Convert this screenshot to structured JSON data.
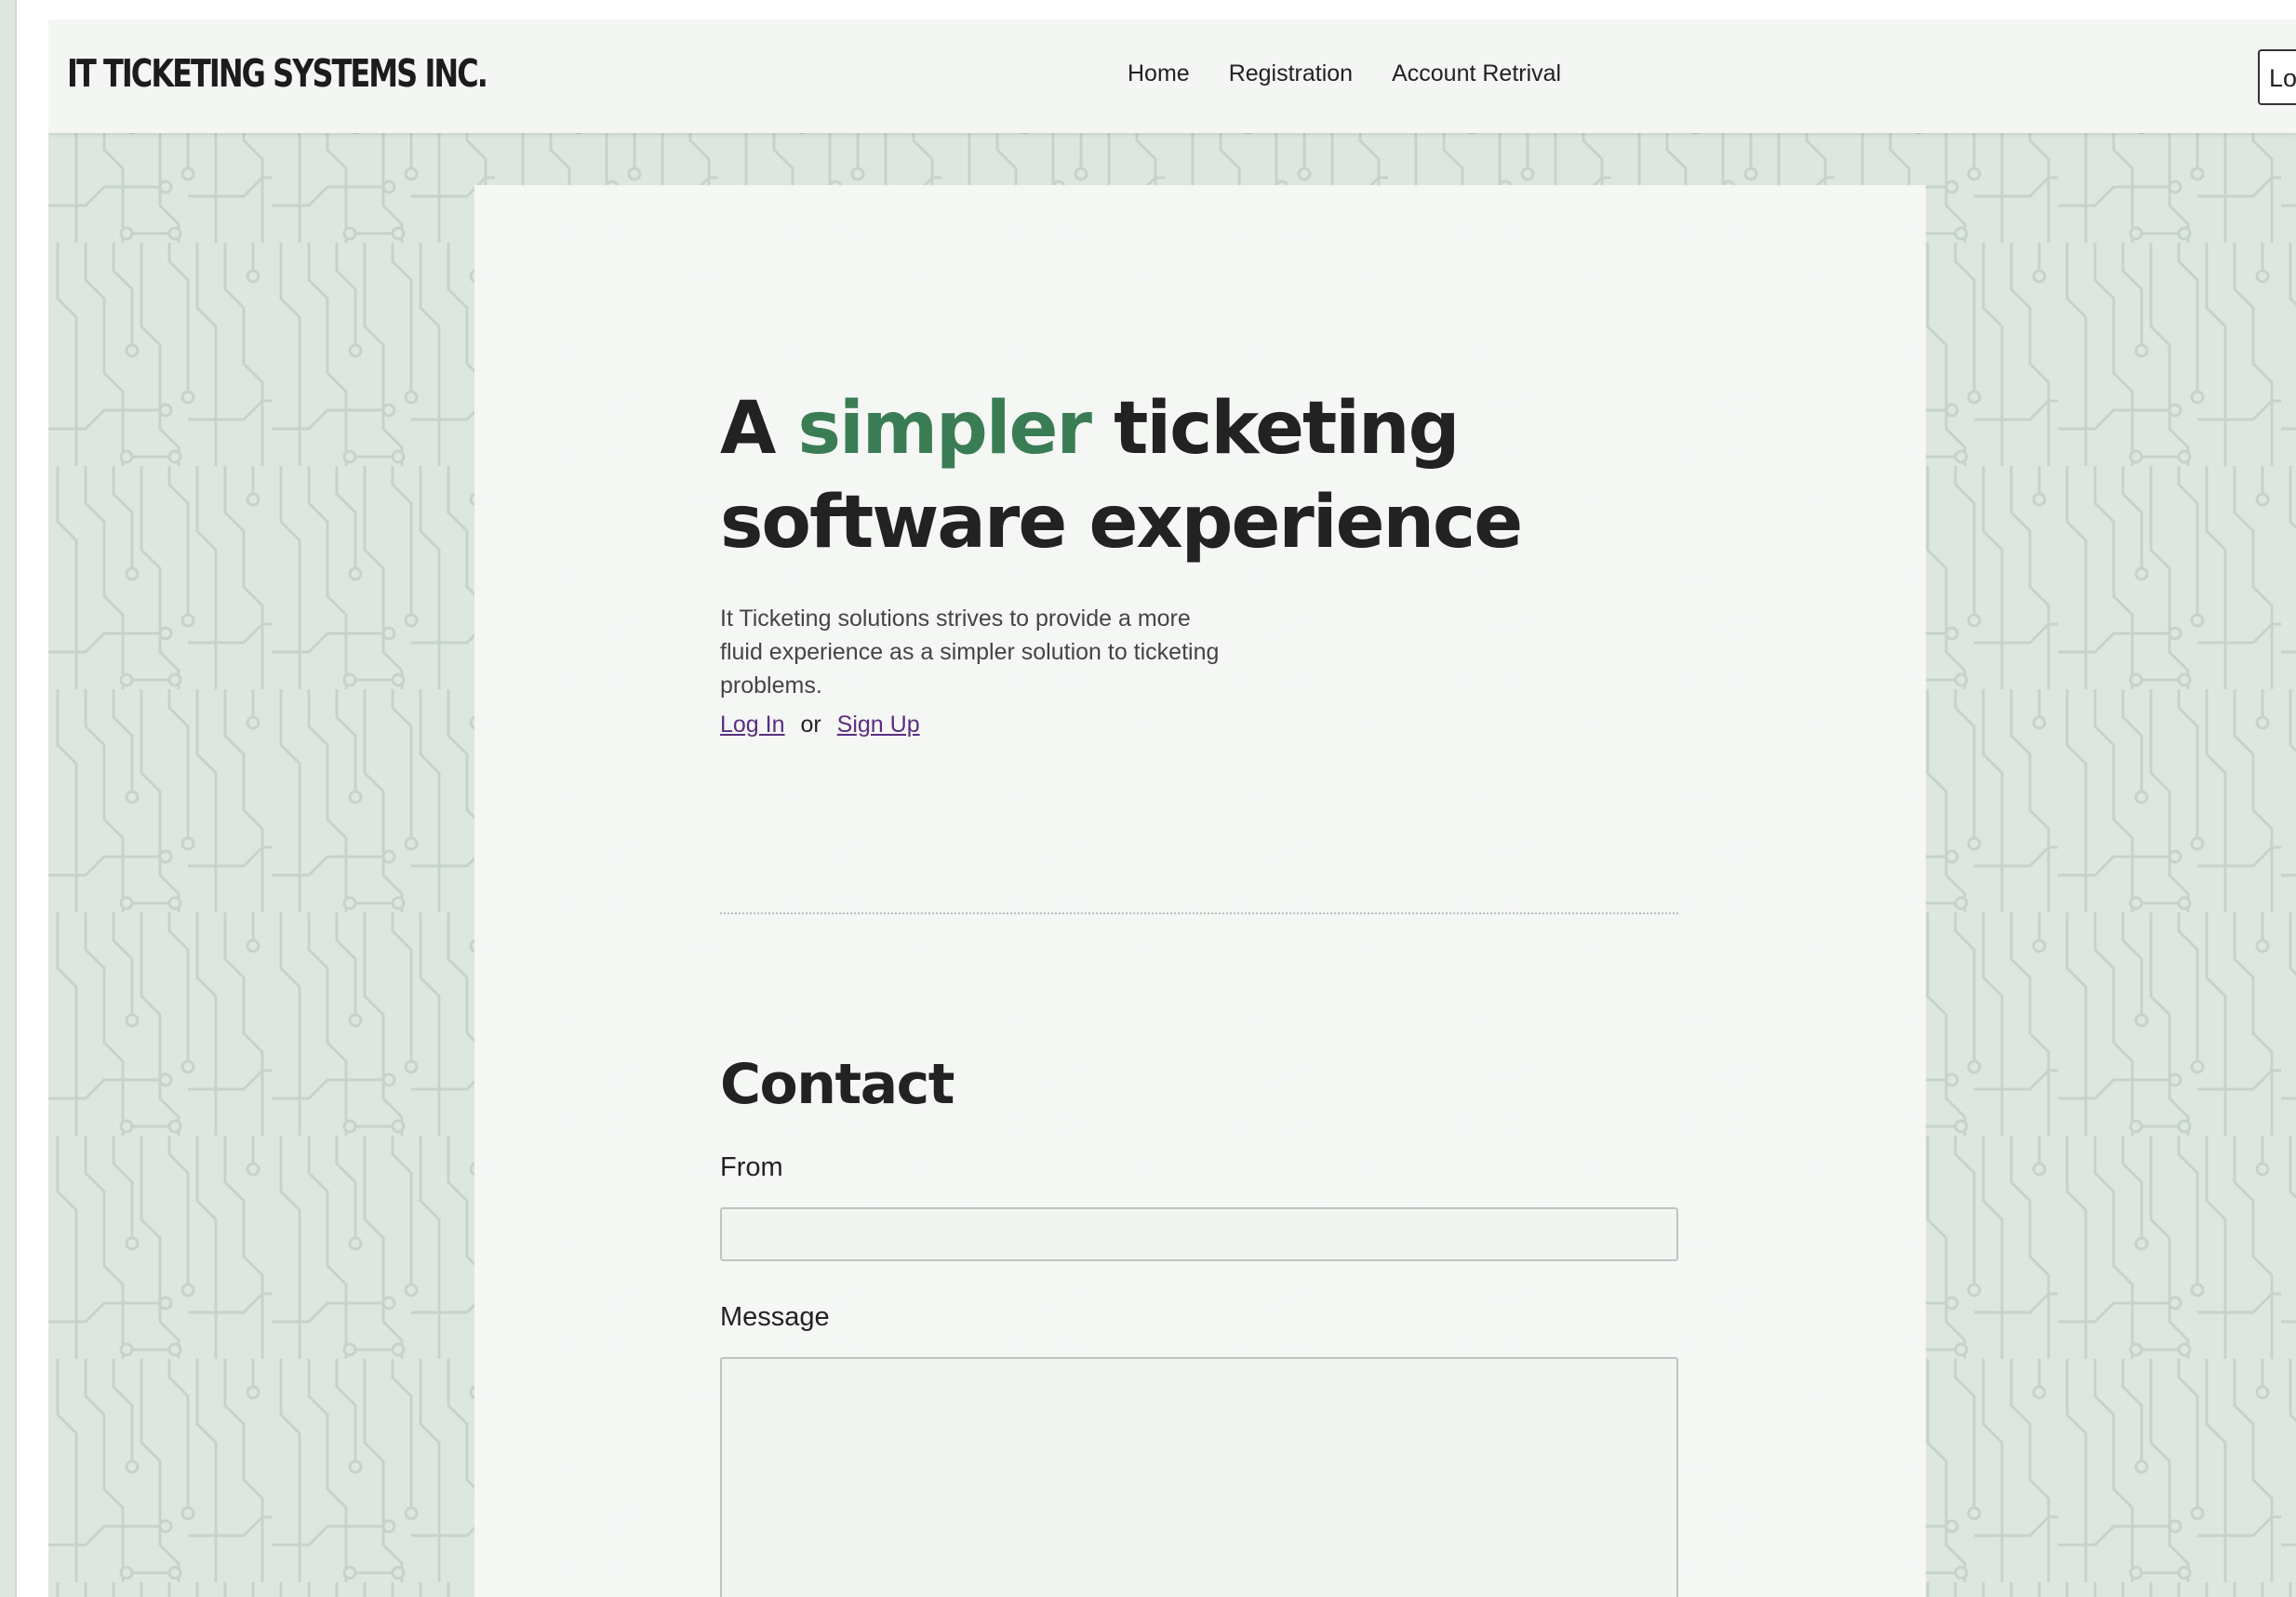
{
  "navbar": {
    "brand": "IT TICKETING SYSTEMS INC.",
    "links": [
      {
        "label": "Home"
      },
      {
        "label": "Registration"
      },
      {
        "label": "Account Retrival"
      }
    ],
    "login_label": "Log"
  },
  "hero": {
    "title_prefix": "A ",
    "title_accent": "simpler",
    "title_rest": " ticketing",
    "title_line2": "software experience",
    "description": "It Ticketing solutions strives to provide a more fluid experience as a simpler solution to ticketing problems.",
    "login_link": "Log In",
    "or_text": "or",
    "signup_link": "Sign Up"
  },
  "contact": {
    "title": "Contact",
    "from_label": "From",
    "from_value": "",
    "message_label": "Message",
    "message_value": ""
  },
  "colors": {
    "accent": "#3a7d55",
    "link": "#5b2e80",
    "page_background": "#dde7df",
    "card_background": "#f6f8f6"
  }
}
